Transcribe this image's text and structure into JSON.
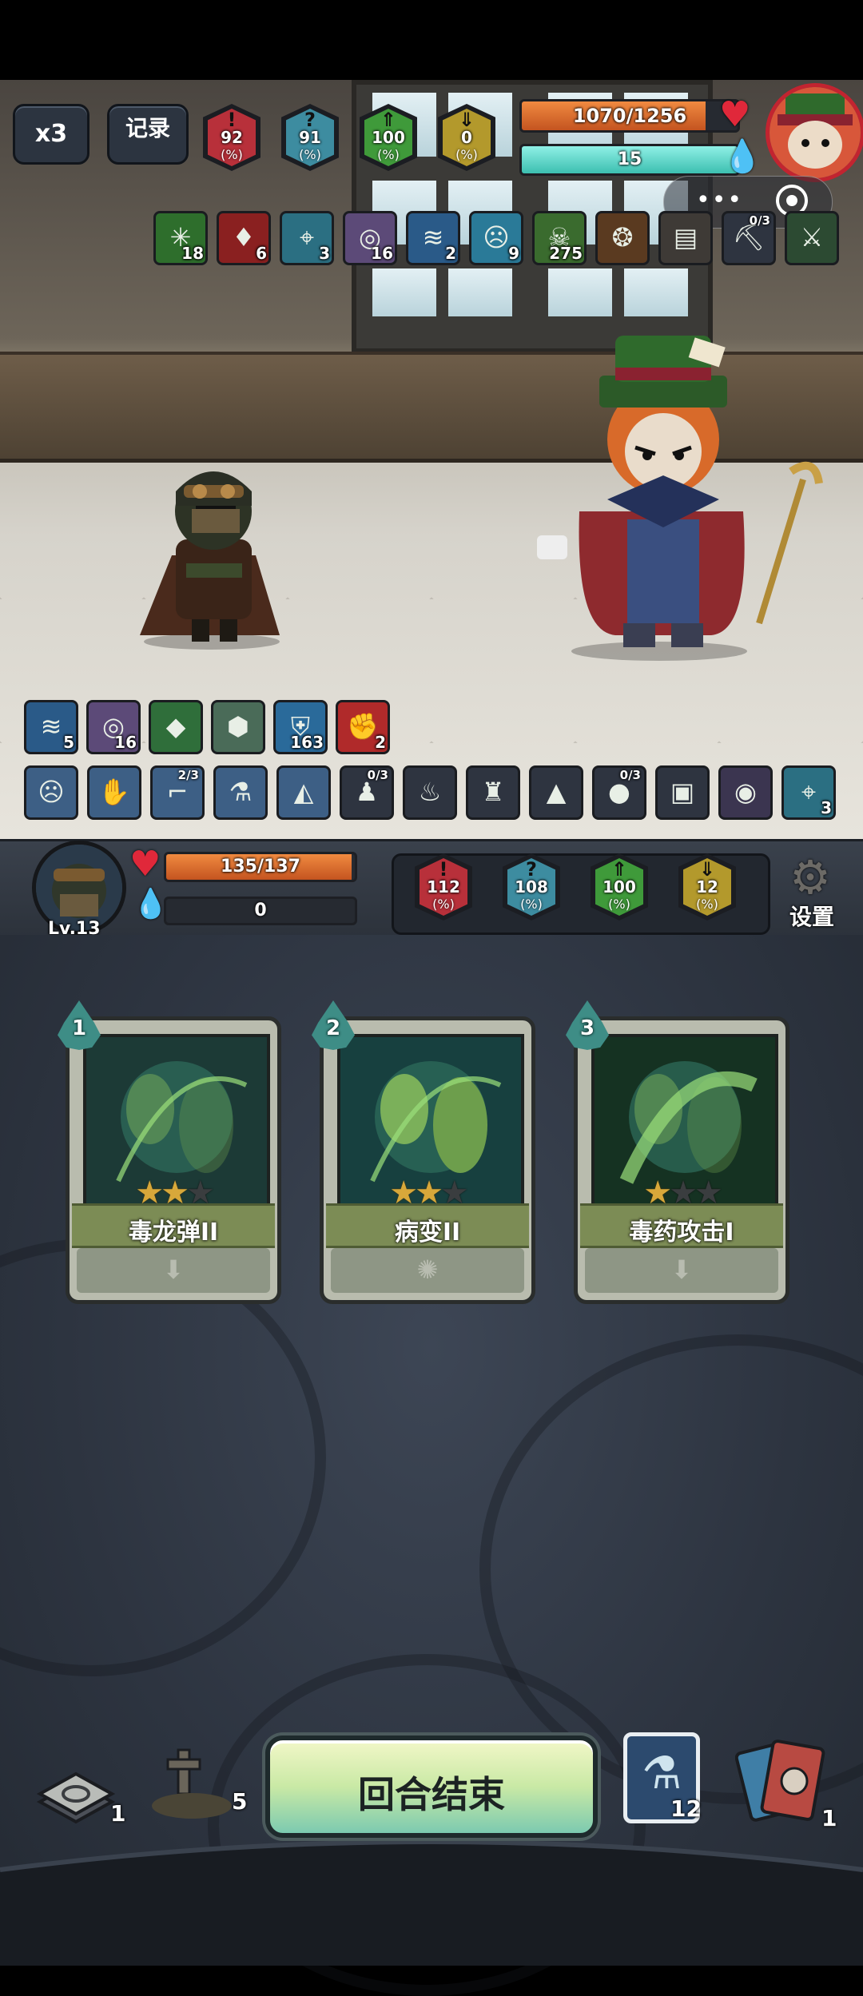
{
  "top_controls": {
    "speed_label": "x3",
    "record_label": "记录"
  },
  "enemy": {
    "hp_text": "1070/1256",
    "hp_fraction": 0.852,
    "shield_text": "15",
    "stats": [
      {
        "value": "92",
        "pct": "(%)",
        "color": "#b8303a",
        "glyph": "!"
      },
      {
        "value": "91",
        "pct": "(%)",
        "color": "#3d8ca0",
        "glyph": "?"
      },
      {
        "value": "100",
        "pct": "(%)",
        "color": "#3f9a3a",
        "glyph": "⇑"
      },
      {
        "value": "0",
        "pct": "(%)",
        "color": "#b3992c",
        "glyph": "⇓"
      }
    ],
    "buffs": [
      {
        "icon": "virus-burst-icon",
        "glyph": "✳",
        "count": "18",
        "bg": "#2e6e2c"
      },
      {
        "icon": "blood-drop-icon",
        "glyph": "♦",
        "count": "6",
        "bg": "#8a2020"
      },
      {
        "icon": "crosshair-icon",
        "glyph": "⌖",
        "count": "3",
        "bg": "#2b6f82"
      },
      {
        "icon": "spiral-icon",
        "glyph": "◎",
        "count": "16",
        "bg": "#5c4a78"
      },
      {
        "icon": "dodge-swirl-icon",
        "glyph": "≋",
        "count": "2",
        "bg": "#2a5a88"
      },
      {
        "icon": "ghost-face-icon",
        "glyph": "☹",
        "count": "9",
        "bg": "#2a7a98"
      },
      {
        "icon": "poison-skull-icon",
        "glyph": "☠",
        "count": "275",
        "bg": "#3a6b2e"
      }
    ],
    "items": [
      {
        "icon": "golden-brain-icon",
        "glyph": "❂",
        "bg": "#5a3a20"
      },
      {
        "icon": "book-icon",
        "glyph": "▤",
        "bg": "#3e3a36"
      },
      {
        "icon": "pickaxe-icon",
        "glyph": "⛏",
        "top": "0/3",
        "bg": "#2e3440"
      },
      {
        "icon": "green-dagger-icon",
        "glyph": "⚔",
        "bg": "#2c4a32"
      }
    ]
  },
  "player": {
    "level": "Lv.13",
    "hp_text": "135/137",
    "hp_fraction": 0.985,
    "shield_text": "0",
    "settings_label": "设置",
    "stats": [
      {
        "value": "112",
        "pct": "(%)",
        "color": "#b8303a",
        "glyph": "!"
      },
      {
        "value": "108",
        "pct": "(%)",
        "color": "#3d8ca0",
        "glyph": "?"
      },
      {
        "value": "100",
        "pct": "(%)",
        "color": "#3f9a3a",
        "glyph": "⇑"
      },
      {
        "value": "12",
        "pct": "(%)",
        "color": "#b3992c",
        "glyph": "⇓"
      }
    ],
    "buffs": [
      {
        "icon": "dodge-swirl-icon",
        "glyph": "≋",
        "count": "5",
        "bg": "#2a5a88"
      },
      {
        "icon": "spiral-icon",
        "glyph": "◎",
        "count": "16",
        "bg": "#5c4a78"
      },
      {
        "icon": "green-crystal-icon",
        "glyph": "◆",
        "count": "",
        "bg": "#2f6e3a"
      },
      {
        "icon": "turtle-shell-icon",
        "glyph": "⬢",
        "count": "",
        "bg": "#4a6b58"
      },
      {
        "icon": "shield-icon",
        "glyph": "⛨",
        "count": "163",
        "bg": "#2a6a9a"
      },
      {
        "icon": "fist-icon",
        "glyph": "✊",
        "count": "2",
        "bg": "#b02a2a"
      }
    ],
    "equipment": [
      {
        "icon": "mask-icon",
        "glyph": "☹",
        "top": "",
        "count": "",
        "bg": "#3d5f85"
      },
      {
        "icon": "glove-icon",
        "glyph": "✋",
        "top": "",
        "count": "",
        "bg": "#3d5f85"
      },
      {
        "icon": "gun-icon",
        "glyph": "⌐",
        "top": "2/3",
        "count": "",
        "bg": "#3d5f85"
      },
      {
        "icon": "flask-icon",
        "glyph": "⚗",
        "top": "",
        "count": "",
        "bg": "#3d5f85"
      },
      {
        "icon": "rock-icon",
        "glyph": "◭",
        "top": "",
        "count": "",
        "bg": "#3d5f85"
      },
      {
        "icon": "hooded-figure-icon",
        "glyph": "♟",
        "top": "0/3",
        "count": "",
        "bg": "#2e3440"
      },
      {
        "icon": "chili-icon",
        "glyph": "♨",
        "top": "",
        "count": "",
        "bg": "#2e3440"
      },
      {
        "icon": "pouch-icon",
        "glyph": "♜",
        "top": "",
        "count": "",
        "bg": "#2e3440"
      },
      {
        "icon": "rice-ball-icon",
        "glyph": "▲",
        "top": "",
        "count": "",
        "bg": "#2e3440"
      },
      {
        "icon": "red-orb-icon",
        "glyph": "●",
        "top": "0/3",
        "count": "",
        "bg": "#2e3440"
      },
      {
        "icon": "card-icon",
        "glyph": "▣",
        "top": "",
        "count": "",
        "bg": "#2e3440"
      },
      {
        "icon": "spiral-disc-icon",
        "glyph": "◉",
        "top": "",
        "count": "",
        "bg": "#3b3550"
      },
      {
        "icon": "crosshair-icon",
        "glyph": "⌖",
        "top": "",
        "count": "3",
        "bg": "#2b6f82"
      }
    ]
  },
  "hand": [
    {
      "cost": "1",
      "name": "毒龙弹II",
      "stars": 2,
      "lower_icon": "arrow-down-icon",
      "lower_glyph": "⬇",
      "art_color": "#1c3a36"
    },
    {
      "cost": "2",
      "name": "病变II",
      "stars": 2,
      "lower_icon": "whistle-icon",
      "lower_glyph": "✺",
      "art_color": "#17403f"
    },
    {
      "cost": "3",
      "name": "毒药攻击I",
      "stars": 1,
      "lower_icon": "arrow-down-icon",
      "lower_glyph": "⬇",
      "art_color": "#153222"
    }
  ],
  "bottom": {
    "draw_pile_count": "1",
    "grave_count": "5",
    "end_turn_label": "回合结束",
    "potion_count": "12",
    "discard_pile_count": "1"
  }
}
